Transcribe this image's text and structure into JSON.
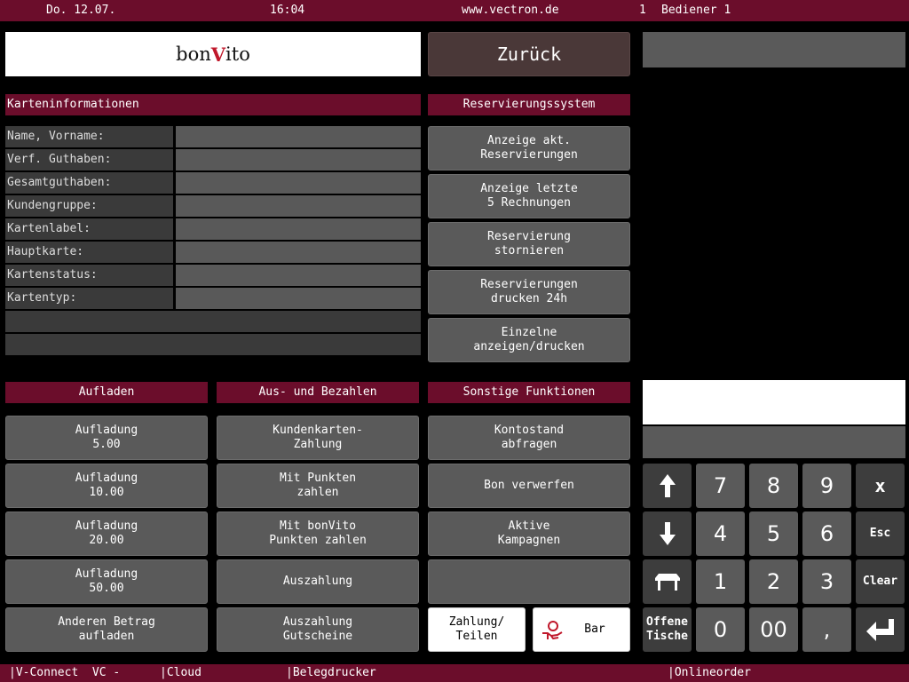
{
  "topbar": {
    "date": "Do. 12.07.",
    "time": "16:04",
    "url": "www.vectron.de",
    "operator_no": "1",
    "operator": "Bediener 1"
  },
  "logo": {
    "text_left": "bon",
    "text_accent": "V",
    "text_right": "ito"
  },
  "back_label": "Zurück",
  "card_info": {
    "header": "Karteninformationen",
    "rows": [
      {
        "label": "Name, Vorname:",
        "value": ""
      },
      {
        "label": "Verf. Guthaben:",
        "value": ""
      },
      {
        "label": "Gesamtguthaben:",
        "value": ""
      },
      {
        "label": "Kundengruppe:",
        "value": ""
      },
      {
        "label": "Kartenlabel:",
        "value": ""
      },
      {
        "label": "Hauptkarte:",
        "value": ""
      },
      {
        "label": "Kartenstatus:",
        "value": ""
      },
      {
        "label": "Kartentyp:",
        "value": ""
      }
    ]
  },
  "reservation": {
    "header": "Reservierungssystem",
    "buttons": [
      "Anzeige akt.\nReservierungen",
      "Anzeige letzte\n5 Rechnungen",
      "Reservierung\nstornieren",
      "Reservierungen\ndrucken 24h",
      "Einzelne\nanzeigen/drucken"
    ]
  },
  "topup": {
    "header": "Aufladen",
    "buttons": [
      "Aufladung\n5.00",
      "Aufladung\n10.00",
      "Aufladung\n20.00",
      "Aufladung\n50.00",
      "Anderen Betrag\naufladen"
    ]
  },
  "payout": {
    "header": "Aus- und Bezahlen",
    "buttons": [
      "Kundenkarten-\nZahlung",
      "Mit Punkten\nzahlen",
      "Mit bonVito\nPunkten zahlen",
      "Auszahlung",
      "Auszahlung\nGutscheine"
    ]
  },
  "other": {
    "header": "Sonstige Funktionen",
    "buttons": [
      "Kontostand\nabfragen",
      "Bon verwerfen",
      "Aktive\nKampagnen",
      ""
    ],
    "pay_split": "Zahlung/\nTeilen",
    "cash": "Bar"
  },
  "keypad": {
    "row1": [
      "7",
      "8",
      "9"
    ],
    "row2": [
      "4",
      "5",
      "6"
    ],
    "row3": [
      "1",
      "2",
      "3"
    ],
    "row4": [
      "0",
      "00",
      ","
    ],
    "x": "x",
    "esc": "Esc",
    "clear": "Clear",
    "open_tables": "Offene\nTische"
  },
  "bottombar": {
    "vconnect": "|V-Connect  VC -",
    "cloud": "|Cloud",
    "printer": "|Belegdrucker",
    "online": "|Onlineorder"
  },
  "colors": {
    "accent": "#6b0d2b",
    "button": "#5a5a5a",
    "back_button": "#4a3838"
  }
}
